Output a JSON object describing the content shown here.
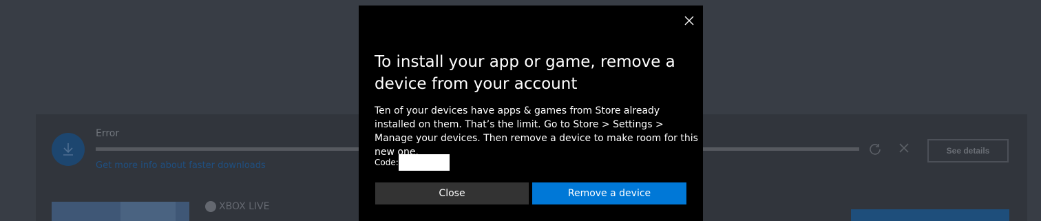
{
  "background": {
    "download": {
      "status": "Error",
      "link_text": "Get more info about faster downloads",
      "see_details_label": "See details"
    },
    "xbox_live_label": "XBOX LIVE"
  },
  "dialog": {
    "title": "To install your app or game, remove a device from your account",
    "body": "Ten of your devices have apps & games from Store already installed on them. That’s the limit. Go to Store > Settings > Manage your devices. Then remove a device to make room for this new one.",
    "code_label": "Code:",
    "code_value": "",
    "buttons": {
      "close": "Close",
      "remove": "Remove a device"
    },
    "colors": {
      "background": "#000000",
      "primary_button": "#0078d7",
      "secondary_button": "#333333"
    }
  }
}
